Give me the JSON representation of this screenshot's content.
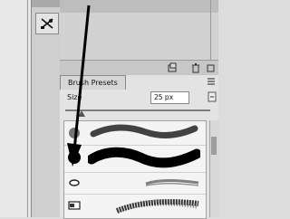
{
  "brush_panel": {
    "tab_label": "Brush Presets",
    "size_label": "Size",
    "size_value": "25 px",
    "brushes": [
      {
        "name": "soft-round-brush"
      },
      {
        "name": "hard-round-brush"
      },
      {
        "name": "small-brush"
      },
      {
        "name": "textured-brush"
      }
    ]
  },
  "icons": {
    "tool": "brush-settings-icon",
    "trash": "trash-icon",
    "new": "new-preset-icon"
  }
}
